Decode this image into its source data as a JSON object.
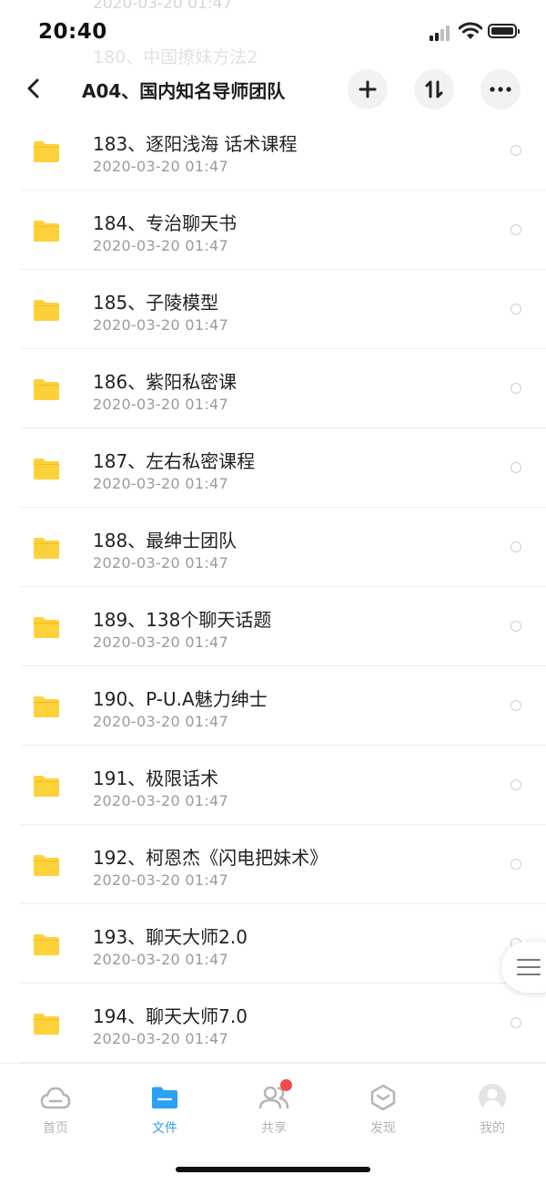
{
  "status_bar": {
    "time": "20:40",
    "ghost_date": "2020-03-20 01:47"
  },
  "nav": {
    "ghost_title": "180、中国撩妹方法2",
    "title": "A04、国内知名导师团队"
  },
  "files": [
    {
      "name": "183、逐阳浅海 话术课程",
      "date": "2020-03-20 01:47"
    },
    {
      "name": "184、专治聊天书",
      "date": "2020-03-20 01:47"
    },
    {
      "name": "185、子陵模型",
      "date": "2020-03-20 01:47"
    },
    {
      "name": "186、紫阳私密课",
      "date": "2020-03-20 01:47"
    },
    {
      "name": "187、左右私密课程",
      "date": "2020-03-20 01:47"
    },
    {
      "name": "188、最绅士团队",
      "date": "2020-03-20 01:47"
    },
    {
      "name": "189、138个聊天话题",
      "date": "2020-03-20 01:47"
    },
    {
      "name": "190、P-U.A魅力绅士",
      "date": "2020-03-20 01:47"
    },
    {
      "name": "191、极限话术",
      "date": "2020-03-20 01:47"
    },
    {
      "name": "192、柯恩杰《闪电把妹术》",
      "date": "2020-03-20 01:47"
    },
    {
      "name": "193、聊天大师2.0",
      "date": "2020-03-20 01:47"
    },
    {
      "name": "194、聊天大师7.0",
      "date": "2020-03-20 01:47"
    }
  ],
  "tabs": [
    {
      "label": "首页",
      "icon": "cloud-icon"
    },
    {
      "label": "文件",
      "icon": "folder-icon"
    },
    {
      "label": "共享",
      "icon": "users-icon"
    },
    {
      "label": "发现",
      "icon": "discover-icon"
    },
    {
      "label": "我的",
      "icon": "avatar-icon"
    }
  ],
  "colors": {
    "accent": "#2ba0f5",
    "folder": "#fdd13a",
    "badge": "#f04b4b",
    "tab_inactive": "#b5b5b5"
  }
}
